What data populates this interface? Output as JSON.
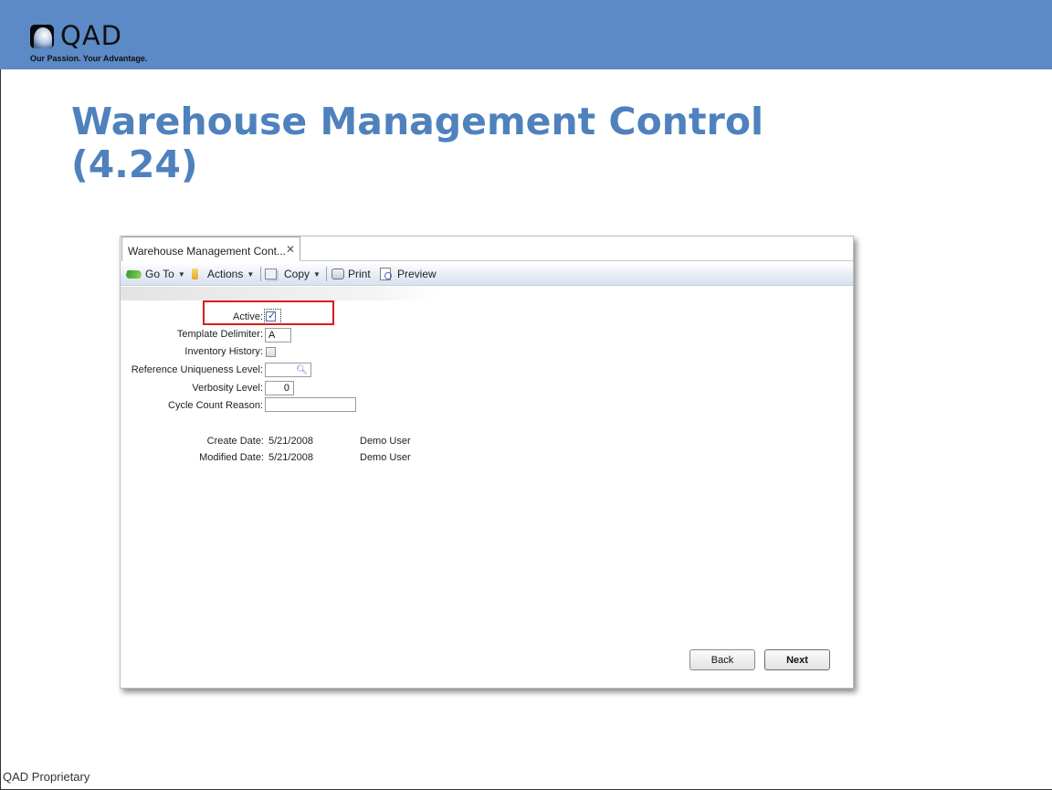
{
  "header": {
    "logo_text": "QAD",
    "tagline": "Our Passion. Your Advantage.",
    "bar_color": "#5b8ac6"
  },
  "slide": {
    "title_line1": "Warehouse Management Control",
    "title_line2": "(4.24)",
    "title_color": "#4f81bd",
    "footer": "QAD Proprietary"
  },
  "window": {
    "tab_label": "Warehouse Management Cont...",
    "toolbar": {
      "goto_label": "Go To",
      "actions_label": "Actions",
      "copy_label": "Copy",
      "print_label": "Print",
      "preview_label": "Preview"
    },
    "form": {
      "active_label": "Active:",
      "active_checked": true,
      "template_delimiter_label": "Template Delimiter:",
      "template_delimiter_value": "A",
      "inventory_history_label": "Inventory History:",
      "inventory_history_checked": false,
      "reference_uniqueness_label": "Reference Uniqueness Level:",
      "reference_uniqueness_value": "",
      "verbosity_label": "Verbosity Level:",
      "verbosity_value": "0",
      "cycle_count_reason_label": "Cycle Count Reason:",
      "cycle_count_reason_value": ""
    },
    "audit": {
      "create_label": "Create Date:",
      "create_date": "5/21/2008",
      "create_user": "Demo User",
      "modified_label": "Modified Date:",
      "modified_date": "5/21/2008",
      "modified_user": "Demo User"
    },
    "buttons": {
      "back_label": "Back",
      "next_label": "Next"
    },
    "highlight_color": "#e01818"
  }
}
